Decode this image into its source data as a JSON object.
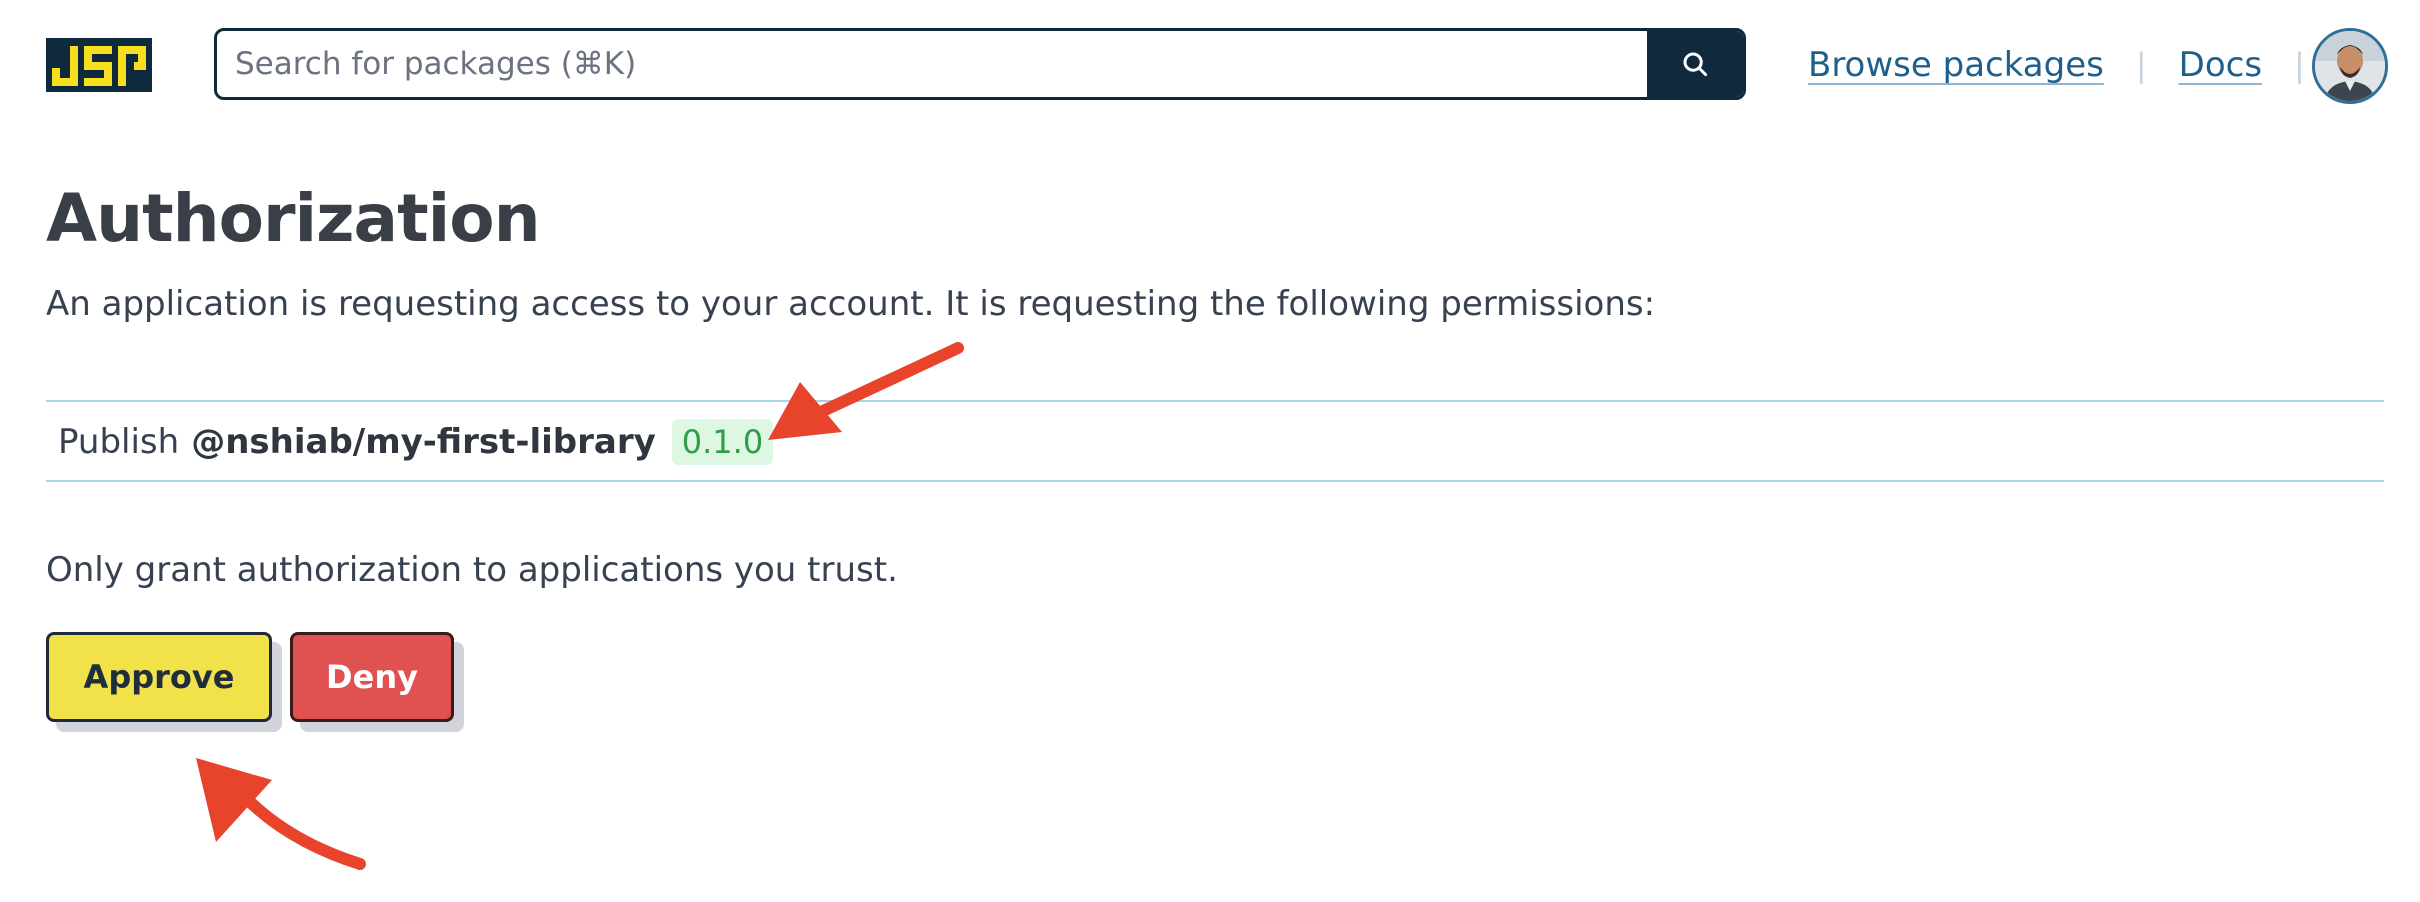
{
  "header": {
    "logo_alt": "JSR",
    "search": {
      "placeholder": "Search for packages (⌘K)",
      "value": ""
    },
    "search_button_icon": "search-icon",
    "nav": {
      "browse_label": "Browse packages",
      "separator": "|",
      "docs_label": "Docs"
    },
    "avatar_icon": "user-avatar"
  },
  "main": {
    "title": "Authorization",
    "intro": "An application is requesting access to your account. It is requesting the following permissions:",
    "permissions": [
      {
        "action": "Publish",
        "package": "@nshiab/my-first-library",
        "version": "0.1.0"
      }
    ],
    "warning": "Only grant authorization to applications you trust.",
    "buttons": {
      "approve_label": "Approve",
      "deny_label": "Deny"
    }
  },
  "colors": {
    "brand_dark": "#0f2a3d",
    "brand_yellow": "#f7df1e",
    "link": "#1f5f8b",
    "approve_bg": "#f2e24a",
    "deny_bg": "#e05252",
    "version_bg": "#ddf7e2",
    "version_text": "#2f9e45",
    "annotation_arrow": "#e8432b"
  },
  "annotations": [
    {
      "type": "arrow",
      "points_to": "permission-version-badge"
    },
    {
      "type": "arrow",
      "points_to": "approve-button"
    }
  ]
}
